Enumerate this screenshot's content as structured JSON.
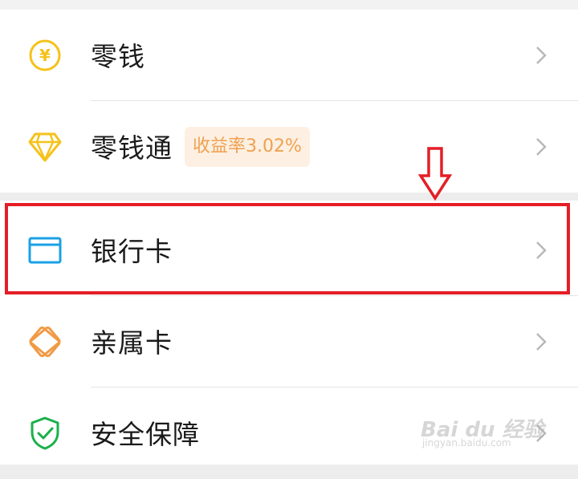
{
  "menu": {
    "items": [
      {
        "label": "零钱",
        "icon": "yuan-coin-icon"
      },
      {
        "label": "零钱通",
        "icon": "diamond-icon",
        "badge": "收益率3.02%"
      },
      {
        "label": "银行卡",
        "icon": "bank-card-icon"
      },
      {
        "label": "亲属卡",
        "icon": "family-card-icon"
      },
      {
        "label": "安全保障",
        "icon": "shield-check-icon"
      }
    ]
  },
  "icons": {
    "yuan_glyph": "¥"
  },
  "colors": {
    "yuan_coin": "#f5c21b",
    "diamond": "#f5c21b",
    "bank_card": "#1aa0e6",
    "family_card": "#f09a45",
    "shield": "#19b04a",
    "badge_bg": "#fdf0e2",
    "badge_text": "#f0a050",
    "highlight": "#e41e26",
    "chevron": "#b8b8b8"
  },
  "annotation": {
    "highlight_target": "银行卡",
    "arrow_direction": "down"
  },
  "watermark": {
    "main": "Bai du 经验",
    "sub": "jingyan.baidu.com"
  }
}
